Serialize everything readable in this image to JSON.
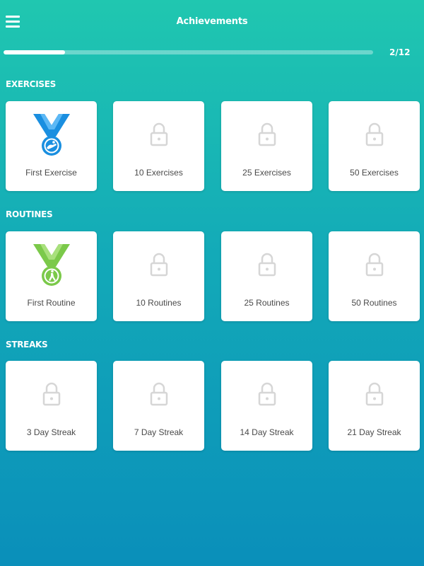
{
  "header": {
    "title": "Achievements",
    "menu_icon": "hamburger-menu-icon"
  },
  "progress": {
    "text": "2/12",
    "fraction": 0.1667
  },
  "colors": {
    "exercise_medal": "#1a8fe0",
    "routine_medal": "#7bc94a",
    "lock": "#d6d6d6"
  },
  "sections": [
    {
      "title": "EXERCISES",
      "cards": [
        {
          "label": "First Exercise",
          "unlocked": true,
          "icon": "blue-medal-icon"
        },
        {
          "label": "10 Exercises",
          "unlocked": false,
          "icon": "lock-icon"
        },
        {
          "label": "25 Exercises",
          "unlocked": false,
          "icon": "lock-icon"
        },
        {
          "label": "50 Exercises",
          "unlocked": false,
          "icon": "lock-icon"
        }
      ]
    },
    {
      "title": "ROUTINES",
      "cards": [
        {
          "label": "First Routine",
          "unlocked": true,
          "icon": "green-medal-icon"
        },
        {
          "label": "10 Routines",
          "unlocked": false,
          "icon": "lock-icon"
        },
        {
          "label": "25 Routines",
          "unlocked": false,
          "icon": "lock-icon"
        },
        {
          "label": "50 Routines",
          "unlocked": false,
          "icon": "lock-icon"
        }
      ]
    },
    {
      "title": "STREAKS",
      "cards": [
        {
          "label": "3 Day Streak",
          "unlocked": false,
          "icon": "lock-icon"
        },
        {
          "label": "7 Day Streak",
          "unlocked": false,
          "icon": "lock-icon"
        },
        {
          "label": "14 Day Streak",
          "unlocked": false,
          "icon": "lock-icon"
        },
        {
          "label": "21 Day Streak",
          "unlocked": false,
          "icon": "lock-icon"
        }
      ]
    }
  ]
}
